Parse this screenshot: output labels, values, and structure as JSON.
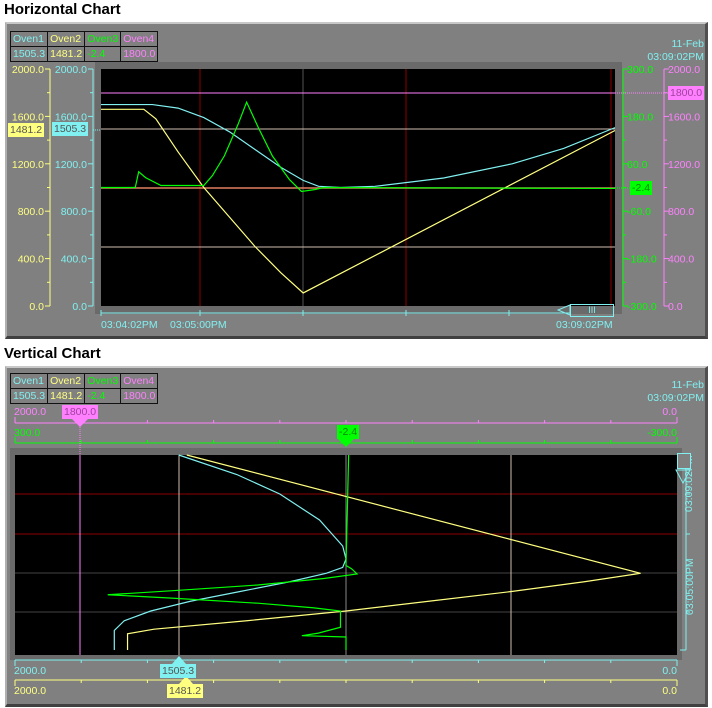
{
  "horizontal": {
    "title": "Horizontal Chart",
    "legend": {
      "names": [
        "Oven1",
        "Oven2",
        "Oven3",
        "Oven4"
      ],
      "values": [
        "1505.3",
        "1481.2",
        "-2.4",
        "1800.0"
      ]
    },
    "date": "11-Feb",
    "time": "03:09:02PM",
    "left_axes": [
      {
        "name": "Oven2",
        "labels": [
          "2000.0",
          "1600.0",
          "1200.0",
          "800.0",
          "400.0",
          "0.0"
        ],
        "min": 0,
        "max": 2000
      },
      {
        "name": "Oven1",
        "labels": [
          "2000.0",
          "1600.0",
          "1200.0",
          "800.0",
          "400.0",
          "0.0"
        ],
        "min": 0,
        "max": 2000
      }
    ],
    "right_axes": [
      {
        "name": "Oven3",
        "labels": [
          "300.0",
          "180.0",
          "60.0",
          "-60.0",
          "-180.0",
          "-300.0"
        ],
        "min": -300,
        "max": 300
      },
      {
        "name": "Oven4",
        "labels": [
          "2000.0",
          "1600.0",
          "1200.0",
          "800.0",
          "400.0",
          "0.0"
        ],
        "min": 0,
        "max": 2000
      }
    ],
    "time_labels": [
      "03:04:02PM",
      "03:05:00PM",
      "03:09:02PM"
    ],
    "markers": {
      "oven1": "1505.3",
      "oven2": "1481.2",
      "oven3": "-2.4",
      "oven4": "1800.0"
    },
    "scroll_label": "III"
  },
  "vertical": {
    "title": "Vertical Chart",
    "legend": {
      "names": [
        "Oven1",
        "Oven2",
        "Oven3",
        "Oven4"
      ],
      "values": [
        "1505.3",
        "1481.2",
        "-2.4",
        "1800.0"
      ]
    },
    "date": "11-Feb",
    "time": "03:09:02PM",
    "top_axes": [
      {
        "name": "Oven4",
        "left": "2000.0",
        "right": "0.0"
      },
      {
        "name": "Oven3",
        "left": "300.0",
        "right": "-300.0"
      }
    ],
    "bottom_axes": [
      {
        "name": "Oven1",
        "left": "2000.0",
        "right": "0.0"
      },
      {
        "name": "Oven2",
        "left": "2000.0",
        "right": "0.0"
      }
    ],
    "time_labels": [
      "03:09:02PM",
      "03:05:00PM"
    ],
    "markers": {
      "oven1": "1505.3",
      "oven2": "1481.2",
      "oven3": "-2.4",
      "oven4": "1800.0"
    }
  },
  "colors": {
    "oven1": "#80f0f0",
    "oven2": "#ffff80",
    "oven3": "#00ff00",
    "oven4": "#ff80ff",
    "grid_red": "#8b0000",
    "limit": "#e08060"
  },
  "trend": {
    "start": "03:04:02",
    "end": "03:09:02",
    "oven1": [
      [
        "03:04:02",
        1700
      ],
      [
        "03:04:32",
        1700
      ],
      [
        "03:04:47",
        1670
      ],
      [
        "03:05:02",
        1590
      ],
      [
        "03:05:17",
        1470
      ],
      [
        "03:05:32",
        1320
      ],
      [
        "03:05:47",
        1170
      ],
      [
        "03:06:00",
        1060
      ],
      [
        "03:06:09",
        1010
      ],
      [
        "03:06:22",
        1000
      ],
      [
        "03:06:42",
        1010
      ],
      [
        "03:07:22",
        1080
      ],
      [
        "03:08:02",
        1200
      ],
      [
        "03:08:32",
        1330
      ],
      [
        "03:09:02",
        1505.3
      ]
    ],
    "oven2": [
      [
        "03:04:02",
        1660
      ],
      [
        "03:04:27",
        1660
      ],
      [
        "03:04:34",
        1580
      ],
      [
        "03:04:47",
        1300
      ],
      [
        "03:05:02",
        1000
      ],
      [
        "03:05:17",
        750
      ],
      [
        "03:05:32",
        500
      ],
      [
        "03:05:47",
        280
      ],
      [
        "03:06:00",
        110
      ],
      [
        "03:09:02",
        1481.2
      ]
    ],
    "oven3": [
      [
        "03:04:02",
        0
      ],
      [
        "03:04:22",
        0
      ],
      [
        "03:04:24",
        40
      ],
      [
        "03:04:28",
        25
      ],
      [
        "03:04:37",
        5
      ],
      [
        "03:05:02",
        5
      ],
      [
        "03:05:07",
        30
      ],
      [
        "03:05:14",
        80
      ],
      [
        "03:05:22",
        160
      ],
      [
        "03:05:27",
        216
      ],
      [
        "03:05:34",
        150
      ],
      [
        "03:05:42",
        80
      ],
      [
        "03:05:52",
        20
      ],
      [
        "03:05:59",
        -10
      ],
      [
        "03:06:07",
        -5
      ],
      [
        "03:06:12",
        0
      ],
      [
        "03:09:02",
        -2.4
      ]
    ],
    "oven4": [
      [
        "03:04:02",
        1800
      ],
      [
        "03:09:02",
        1800
      ]
    ]
  }
}
